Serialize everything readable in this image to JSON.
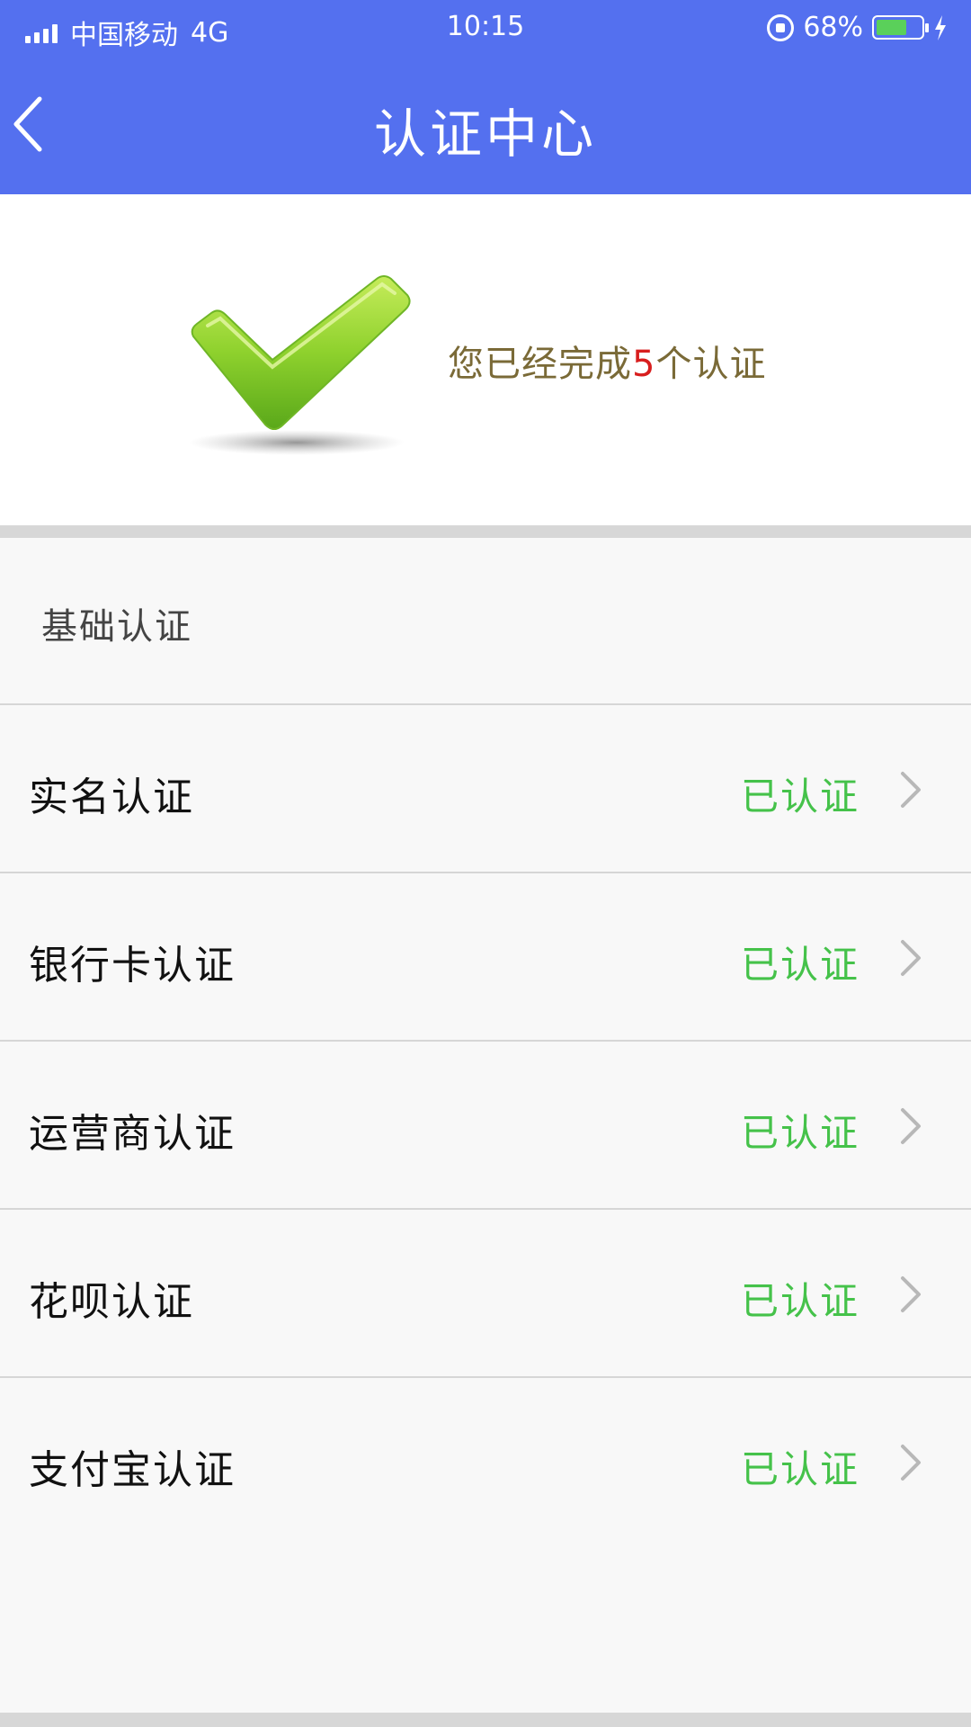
{
  "status_bar": {
    "carrier": "中国移动",
    "network": "4G",
    "time": "10:15",
    "battery": "68%"
  },
  "header": {
    "title": "认证中心"
  },
  "summary": {
    "prefix": "您已经完成",
    "count": "5",
    "suffix": "个认证",
    "icon": "checkmark-icon"
  },
  "section": {
    "title": "基础认证"
  },
  "items": [
    {
      "label": "实名认证",
      "status": "已认证"
    },
    {
      "label": "银行卡认证",
      "status": "已认证"
    },
    {
      "label": "运营商认证",
      "status": "已认证"
    },
    {
      "label": "花呗认证",
      "status": "已认证"
    },
    {
      "label": "支付宝认证",
      "status": "已认证"
    }
  ],
  "colors": {
    "header_bg": "#5470ef",
    "status_green": "#45c24a",
    "count_red": "#d81e1e",
    "summary_text": "#7a6a37"
  }
}
